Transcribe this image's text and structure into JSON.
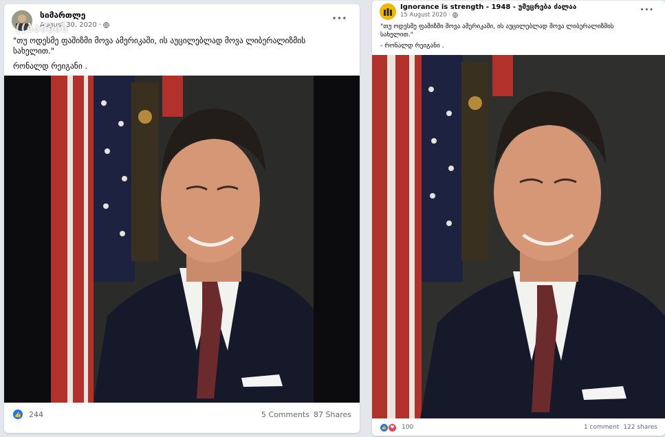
{
  "post_left": {
    "author": "სიმართლე",
    "date": "August 30, 2020 ·",
    "quote": "\"თუ ოდესმე ფაშიზმი მოვა ამერიკაში, ის აუცილებლად მოვა ლიბერალიზმის სახელით.\"",
    "signature": "რონალდ რეიგანი .",
    "reactions_count": "244",
    "comments": "5 Comments",
    "shares": "87 Shares",
    "watermark": "((ბამბის",
    "colors": {
      "like": "#1877f2",
      "flag_red": "#b3312b",
      "suit": "#16192a"
    }
  },
  "post_right": {
    "author": "Ignorance is strength - 1948 - უმეცრება ძალაა",
    "date": "15 August 2020 ·",
    "quote": "\"თუ ოდესმე ფაშიზმი მოვა ამერიკაში, ის აუცილებლად მოვა ლიბერალიზმის სახელით.\"",
    "signature": "- რონალდ რეიგანი .",
    "reactions_count": "100",
    "comments": "1 comment",
    "shares": "122 shares",
    "colors": {
      "like": "#1877f2",
      "love": "#f33e58",
      "avatar_bg": "#f2b705"
    }
  },
  "icons": {
    "menu": "more-dots-icon",
    "privacy": "globe-icon",
    "like": "like-icon",
    "love": "love-icon"
  },
  "more_label": "•••",
  "like_glyph": "👍",
  "love_glyph": "♥"
}
